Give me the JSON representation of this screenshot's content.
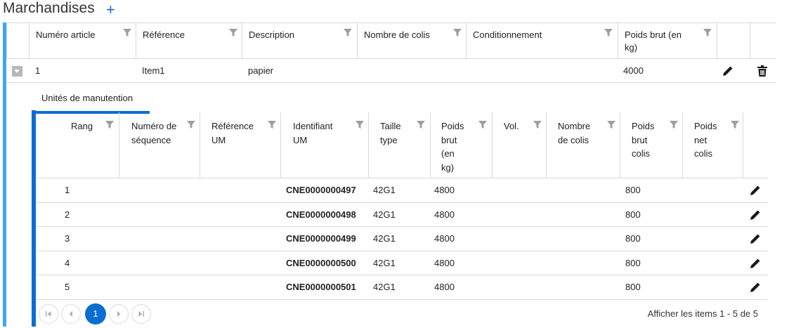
{
  "section": {
    "title": "Marchandises",
    "add_label": "+"
  },
  "outer_grid": {
    "columns": [
      {
        "label": "Numéro article"
      },
      {
        "label": "Référence"
      },
      {
        "label": "Description"
      },
      {
        "label": "Nombre de colis"
      },
      {
        "label": "Conditionnement"
      },
      {
        "label": "Poids brut (en kg)"
      }
    ],
    "rows": [
      {
        "numero_article": "1",
        "reference": "Item1",
        "description": "papier",
        "nombre_colis": "",
        "conditionnement": "",
        "poids_brut": "4000"
      }
    ]
  },
  "detail": {
    "tab_label": "Unités de manutention"
  },
  "inner_grid": {
    "columns": [
      {
        "label": "Rang"
      },
      {
        "label": "Numéro de séquence"
      },
      {
        "label": "Référence UM"
      },
      {
        "label": "Identifiant UM"
      },
      {
        "label": "Taille type"
      },
      {
        "label": "Poids brut (en kg)"
      },
      {
        "label": "Vol."
      },
      {
        "label": "Nombre de colis"
      },
      {
        "label": "Poids brut colis"
      },
      {
        "label": "Poids net colis"
      }
    ],
    "rows": [
      {
        "rang": "1",
        "numero_sequence": "",
        "reference_um": "",
        "identifiant_um": "CNE0000000497",
        "taille_type": "42G1",
        "poids_brut": "4800",
        "vol": "",
        "nombre_colis": "",
        "poids_brut_colis": "800",
        "poids_net_colis": ""
      },
      {
        "rang": "2",
        "numero_sequence": "",
        "reference_um": "",
        "identifiant_um": "CNE0000000498",
        "taille_type": "42G1",
        "poids_brut": "4800",
        "vol": "",
        "nombre_colis": "",
        "poids_brut_colis": "800",
        "poids_net_colis": ""
      },
      {
        "rang": "3",
        "numero_sequence": "",
        "reference_um": "",
        "identifiant_um": "CNE0000000499",
        "taille_type": "42G1",
        "poids_brut": "4800",
        "vol": "",
        "nombre_colis": "",
        "poids_brut_colis": "800",
        "poids_net_colis": ""
      },
      {
        "rang": "4",
        "numero_sequence": "",
        "reference_um": "",
        "identifiant_um": "CNE0000000500",
        "taille_type": "42G1",
        "poids_brut": "4800",
        "vol": "",
        "nombre_colis": "",
        "poids_brut_colis": "800",
        "poids_net_colis": ""
      },
      {
        "rang": "5",
        "numero_sequence": "",
        "reference_um": "",
        "identifiant_um": "CNE0000000501",
        "taille_type": "42G1",
        "poids_brut": "4800",
        "vol": "",
        "nombre_colis": "",
        "poids_brut_colis": "800",
        "poids_net_colis": ""
      }
    ]
  },
  "pager": {
    "current_page": "1",
    "info": "Afficher les items 1 - 5 de 5"
  },
  "icons": {
    "filter": "filter-icon",
    "edit": "pencil-icon",
    "delete": "trash-icon",
    "expand": "chevron-down-icon"
  },
  "colors": {
    "accent": "#0a6ed1",
    "outer_accent": "#42a5f5",
    "filter_icon": "#9e9e9e",
    "grid_line": "#d9d9d9"
  }
}
